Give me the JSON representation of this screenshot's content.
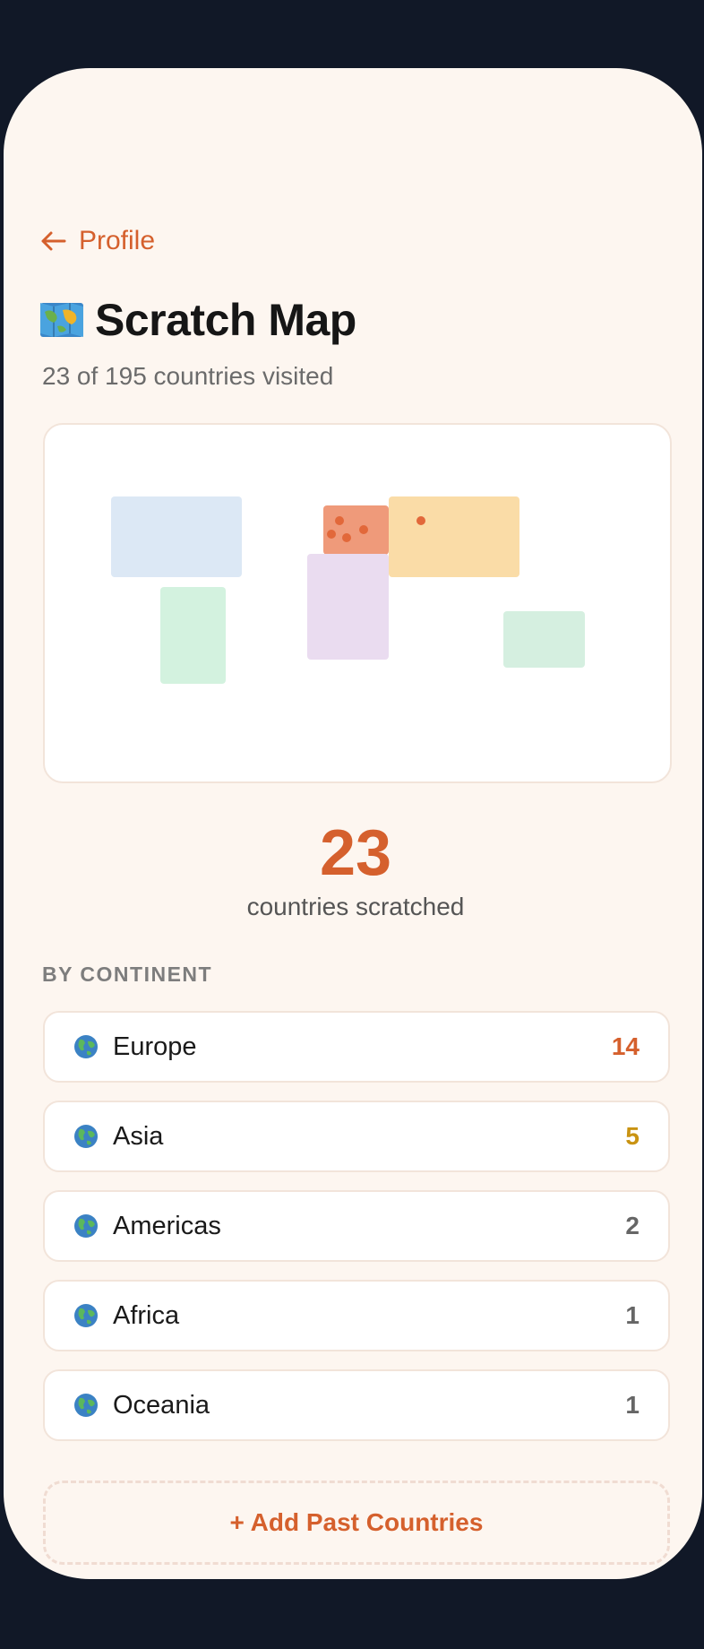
{
  "header": {
    "back_label": "Profile",
    "title": "Scratch Map",
    "subtitle": "23 of 195 countries visited"
  },
  "icons": {
    "back": "arrow-left-icon",
    "title": "world-map-icon",
    "continent": "globe-icon"
  },
  "colors": {
    "accent": "#d5602d",
    "background": "#fdf6f0",
    "card_border": "#f2e4da"
  },
  "map": {
    "regions": [
      {
        "name": "north-america",
        "color": "#dce8f5",
        "visited": false
      },
      {
        "name": "south-america",
        "color": "#d3f2df",
        "visited": false
      },
      {
        "name": "europe",
        "color": "#ef9a7a",
        "visited": true
      },
      {
        "name": "africa",
        "color": "#eadcf0",
        "visited": false
      },
      {
        "name": "asia",
        "color": "#fadca7",
        "visited": true
      },
      {
        "name": "oceania",
        "color": "#d5efe0",
        "visited": false
      }
    ]
  },
  "stats": {
    "count": "23",
    "count_label": "countries scratched"
  },
  "continents": {
    "section_label": "BY CONTINENT",
    "items": [
      {
        "name": "Europe",
        "count": "14",
        "color": "#d5602d"
      },
      {
        "name": "Asia",
        "count": "5",
        "color": "#c99312"
      },
      {
        "name": "Americas",
        "count": "2",
        "color": "#666666"
      },
      {
        "name": "Africa",
        "count": "1",
        "color": "#666666"
      },
      {
        "name": "Oceania",
        "count": "1",
        "color": "#666666"
      }
    ]
  },
  "actions": {
    "add_past_countries": "+ Add Past Countries"
  }
}
